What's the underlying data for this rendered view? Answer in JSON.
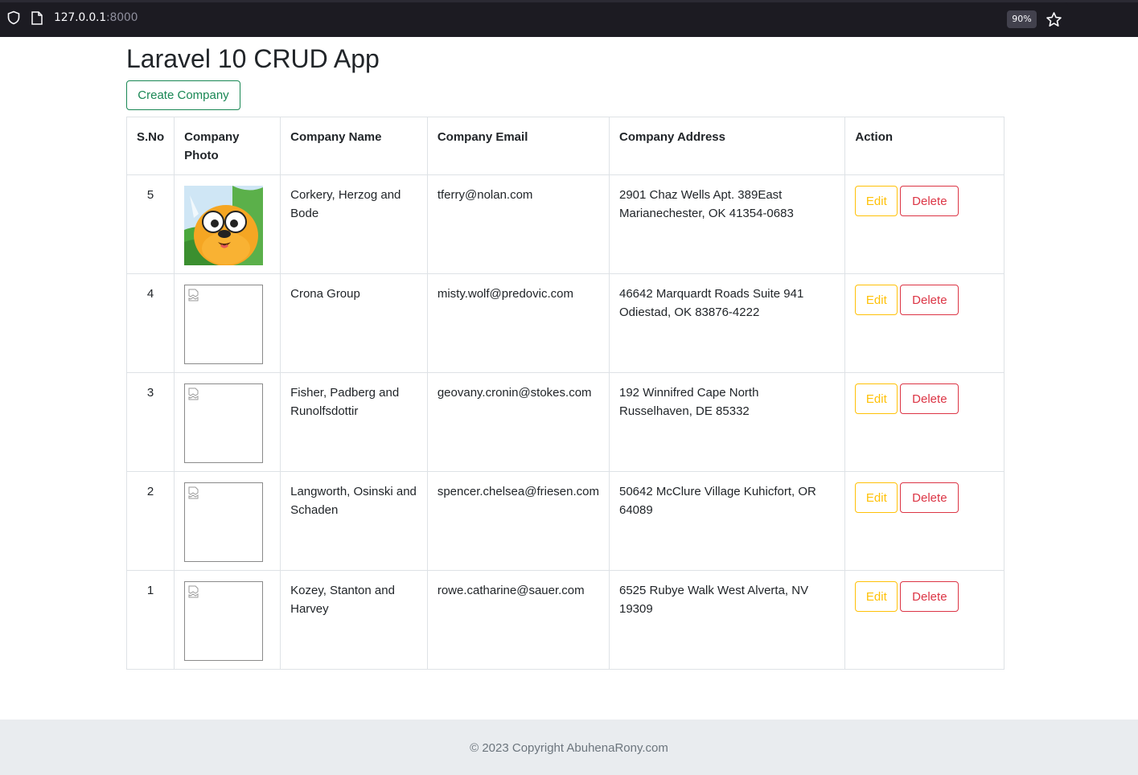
{
  "browser": {
    "url_host": "127.0.0.1",
    "url_port": ":8000",
    "zoom": "90%"
  },
  "page": {
    "title": "Laravel 10 CRUD App",
    "create_label": "Create Company"
  },
  "table": {
    "headers": [
      "S.No",
      "Company Photo",
      "Company Name",
      "Company Email",
      "Company Address",
      "Action"
    ],
    "rows": [
      {
        "sno": "5",
        "photo": "cartoon-dog",
        "name": "Corkery, Herzog and Bode",
        "email": "tferry@nolan.com",
        "address": "2901 Chaz Wells Apt. 389East Marianechester, OK 41354-0683",
        "edit": "Edit",
        "delete": "Delete"
      },
      {
        "sno": "4",
        "photo": "broken-image",
        "name": "Crona Group",
        "email": "misty.wolf@predovic.com",
        "address": "46642 Marquardt Roads Suite 941 Odiestad, OK 83876-4222",
        "edit": "Edit",
        "delete": "Delete"
      },
      {
        "sno": "3",
        "photo": "broken-image",
        "name": "Fisher, Padberg and Runolfsdottir",
        "email": "geovany.cronin@stokes.com",
        "address": "192 Winnifred Cape North Russelhaven, DE 85332",
        "edit": "Edit",
        "delete": "Delete"
      },
      {
        "sno": "2",
        "photo": "broken-image",
        "name": "Langworth, Osinski and Schaden",
        "email": "spencer.chelsea@friesen.com",
        "address": "50642 McClure Village Kuhicfort, OR 64089",
        "edit": "Edit",
        "delete": "Delete"
      },
      {
        "sno": "1",
        "photo": "broken-image",
        "name": "Kozey, Stanton and Harvey",
        "email": "rowe.catharine@sauer.com",
        "address": "6525 Rubye Walk West Alverta, NV 19309",
        "edit": "Edit",
        "delete": "Delete"
      }
    ]
  },
  "footer": {
    "text": "© 2023 Copyright AbuhenaRony.com"
  },
  "colors": {
    "success": "#198754",
    "warning": "#ffc107",
    "danger": "#dc3545",
    "footer_bg": "#e9ecef"
  }
}
